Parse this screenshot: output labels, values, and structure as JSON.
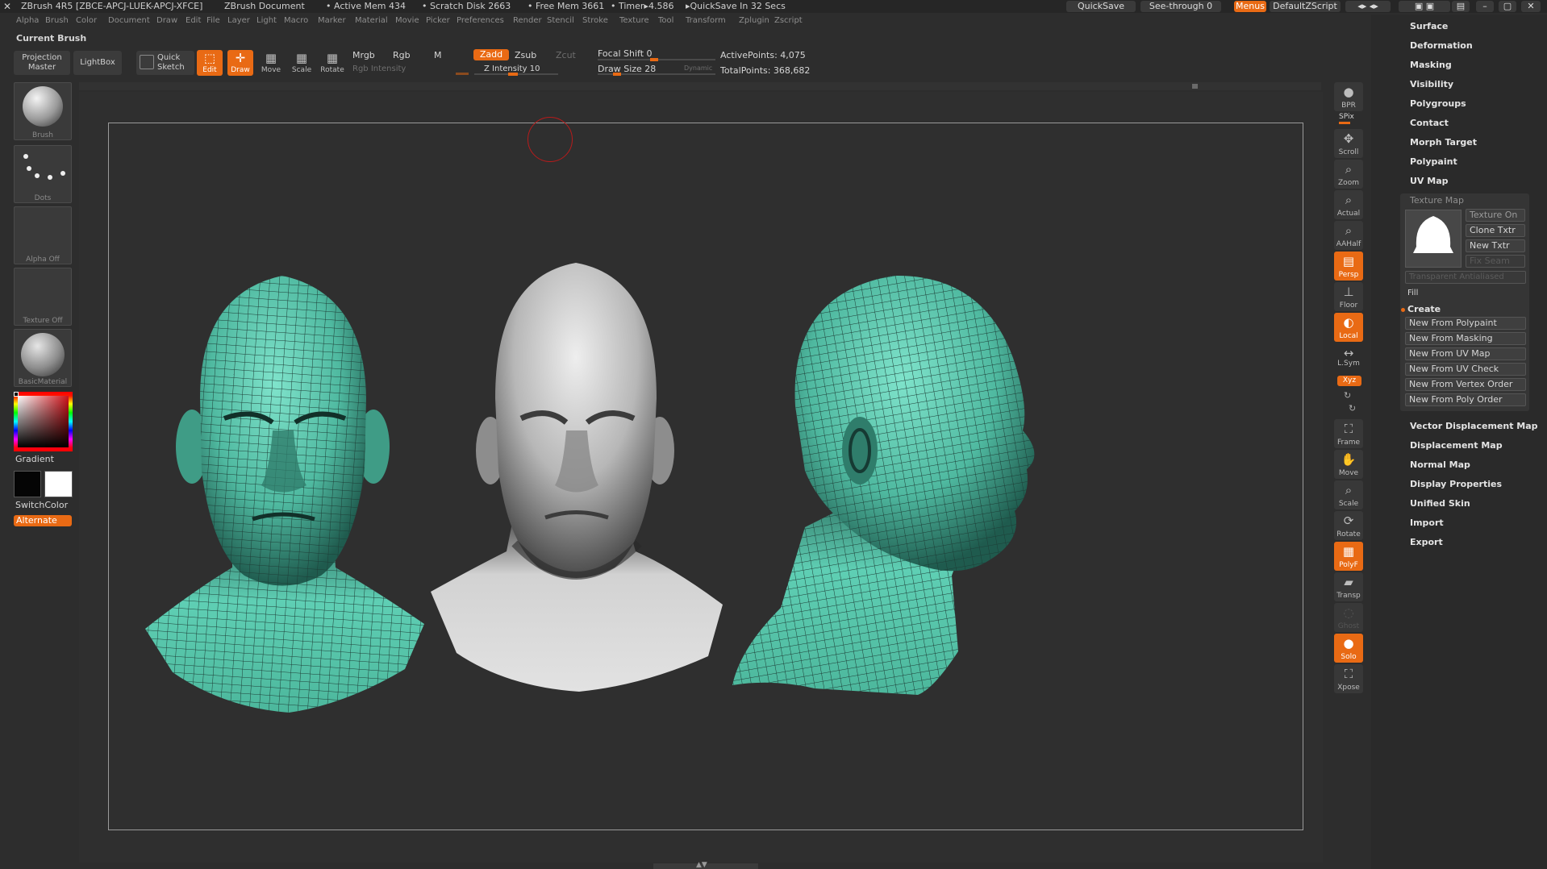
{
  "title": {
    "app": "ZBrush 4R5 [ZBCE-APCJ-LUEK-APCJ-XFCE]",
    "document": "ZBrush Document",
    "active_mem": "• Active Mem 434",
    "scratch_disk": "• Scratch Disk 2663",
    "free_mem": "• Free Mem 3661",
    "timer": "• Timer▸4.586",
    "quicksave_info": "▸QuickSave In 32 Secs",
    "quicksave_btn": "QuickSave",
    "seethrough_btn": "See-through  0",
    "menus_btn": "Menus",
    "script_btn": "DefaultZScript"
  },
  "menus": [
    "Alpha",
    "Brush",
    "Color",
    "Document",
    "Draw",
    "Edit",
    "File",
    "Layer",
    "Light",
    "Macro",
    "Marker",
    "Material",
    "Movie",
    "Picker",
    "Preferences",
    "Render",
    "Stencil",
    "Stroke",
    "Texture",
    "Tool",
    "Transform",
    "Zplugin",
    "Zscript"
  ],
  "toolbar": {
    "current_brush": "Current Brush",
    "projection_master": "Projection\nMaster",
    "lightbox": "LightBox",
    "quick_sketch": "Quick\nSketch",
    "edit": "Edit",
    "draw": "Draw",
    "move": "Move",
    "scale": "Scale",
    "rotate": "Rotate",
    "mrgb": "Mrgb",
    "rgb": "Rgb",
    "m": "M",
    "zadd": "Zadd",
    "zsub": "Zsub",
    "zcut": "Zcut",
    "rgb_intensity": "Rgb Intensity",
    "z_intensity": "Z Intensity 10",
    "focal_shift": "Focal Shift 0",
    "draw_size": "Draw Size 28",
    "dynamic": "Dynamic",
    "active_points": "ActivePoints: 4,075",
    "total_points": "TotalPoints: 368,682"
  },
  "left_shelf": {
    "brush": "Brush",
    "dots": "Dots",
    "alpha": "Alpha  Off",
    "texture": "Texture  Off",
    "material": "BasicMaterial",
    "gradient": "Gradient",
    "switch_color": "SwitchColor",
    "alternate": "Alternate"
  },
  "right_shelf": [
    "BPR",
    "SPix",
    "Scroll",
    "Zoom",
    "Actual",
    "AAHalf",
    "Persp",
    "Floor",
    "Local",
    "L.Sym",
    "Xyz",
    "Frame",
    "Move",
    "Scale",
    "Rotate",
    "PolyF",
    "Transp",
    "Ghost",
    "Solo",
    "Xpose"
  ],
  "palette": {
    "items_top": [
      "Surface",
      "Deformation",
      "Masking",
      "Visibility",
      "Polygroups",
      "Contact",
      "Morph Target",
      "Polypaint",
      "UV Map"
    ],
    "texture_map": {
      "title": "Texture Map",
      "texture_on": "Texture On",
      "clone_txtr": "Clone Txtr",
      "new_txtr": "New Txtr",
      "fix_seam": "Fix Seam",
      "transparent": "Transparent  Antialiased",
      "fill": "Fill",
      "create": "Create",
      "create_items": [
        "New From Polypaint",
        "New From Masking",
        "New From UV Map",
        "New From UV Check",
        "New From Vertex Order",
        "New From Poly Order"
      ]
    },
    "items_bottom": [
      "Vector Displacement Map",
      "Displacement Map",
      "Normal Map",
      "Display Properties",
      "Unified Skin",
      "Import",
      "Export"
    ]
  },
  "colors": {
    "accent": "#e96a14",
    "mesh": "#58cbb1",
    "wire": "#1f3d37",
    "clay": "#bfbfbf"
  }
}
